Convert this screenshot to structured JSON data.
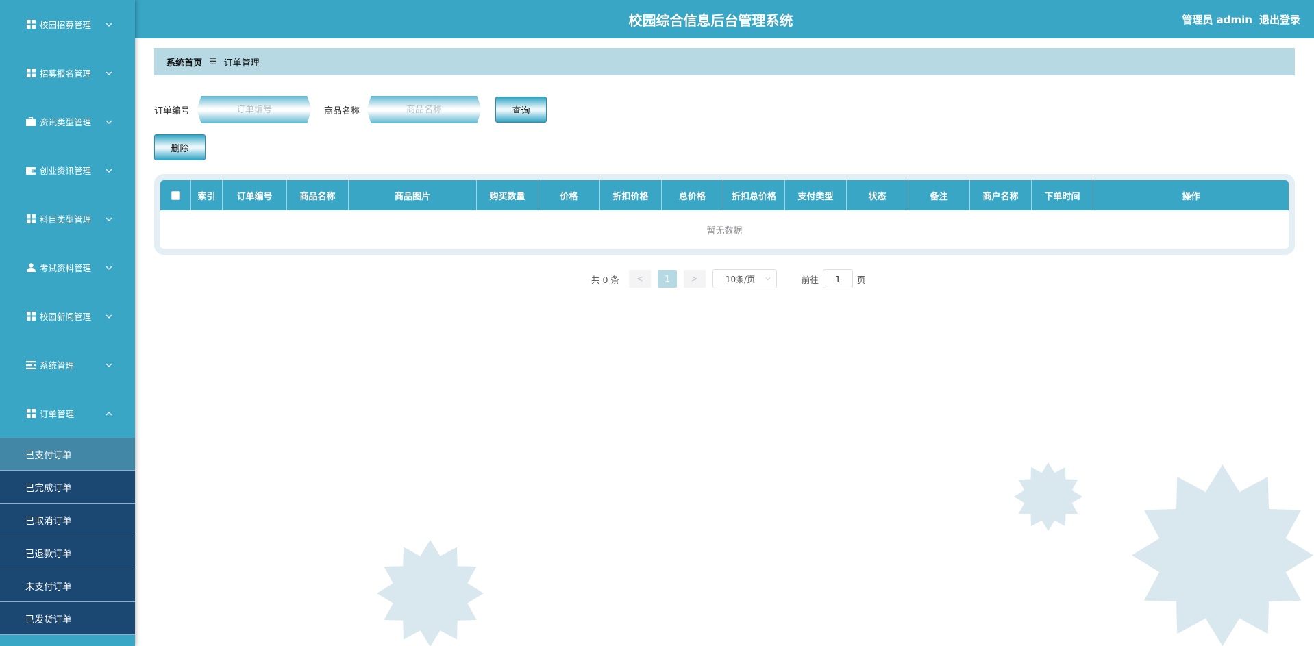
{
  "header": {
    "title": "校园综合信息后台管理系统",
    "user_label": "管理员 admin",
    "logout": "退出登录"
  },
  "sidebar": {
    "items": [
      {
        "label": "校园招募管理",
        "icon": "grid-icon"
      },
      {
        "label": "招募报名管理",
        "icon": "grid-icon"
      },
      {
        "label": "资讯类型管理",
        "icon": "briefcase-icon"
      },
      {
        "label": "创业资讯管理",
        "icon": "wallet-icon"
      },
      {
        "label": "科目类型管理",
        "icon": "grid-icon"
      },
      {
        "label": "考试资料管理",
        "icon": "user-icon"
      },
      {
        "label": "校园新闻管理",
        "icon": "grid-icon"
      },
      {
        "label": "系统管理",
        "icon": "list-icon"
      },
      {
        "label": "订单管理",
        "icon": "grid-icon"
      }
    ],
    "submenu": [
      "已支付订单",
      "已完成订单",
      "已取消订单",
      "已退款订单",
      "未支付订单",
      "已发货订单"
    ]
  },
  "breadcrumb": {
    "home": "系统首页",
    "current": "订单管理"
  },
  "search": {
    "order_no_label": "订单编号",
    "order_no_placeholder": "订单编号",
    "product_label": "商品名称",
    "product_placeholder": "商品名称",
    "query_button": "查询",
    "delete_button": "删除"
  },
  "table": {
    "columns": [
      "索引",
      "订单编号",
      "商品名称",
      "商品图片",
      "购买数量",
      "价格",
      "折扣价格",
      "总价格",
      "折扣总价格",
      "支付类型",
      "状态",
      "备注",
      "商户名称",
      "下单时间",
      "操作"
    ],
    "empty_text": "暂无数据"
  },
  "pagination": {
    "total": "共 0 条",
    "prev": "<",
    "current_page": "1",
    "next": ">",
    "page_size": "10条/页",
    "goto_label": "前往",
    "goto_value": "1",
    "page_unit": "页"
  },
  "colors": {
    "primary": "#38a6c4",
    "submenu_bg": "#1b4873",
    "submenu_active": "#4387a6",
    "breadcrumb_bg": "#b6d9e4",
    "decor": "#d9e8ee"
  }
}
